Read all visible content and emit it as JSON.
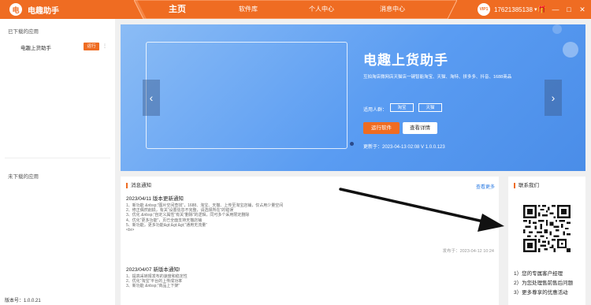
{
  "header": {
    "logo_char": "电",
    "title": "电趣助手",
    "nav": [
      "主页",
      "软件库",
      "个人中心",
      "消息中心"
    ],
    "vip_label": "VIP1",
    "phone": "17621385138",
    "chevron_glyph": "▾",
    "controls": {
      "gift": "🎁",
      "minimize": "—",
      "maximize": "□",
      "close": "✕"
    }
  },
  "sidebar": {
    "downloaded_heading": "已下载的应用",
    "app_name": "电趣上货助手",
    "run_badge": "运行",
    "more": "⋮",
    "not_downloaded_heading": "未下载的应用",
    "version": "版本号：1.0.0.21"
  },
  "banner": {
    "prev": "‹",
    "next": "›",
    "title": "电趣上货助手",
    "subtitle": "互拍淘店微网店天猫店一键智能淘宝、天猫、淘特、拼多多、抖音、1688商品",
    "people_label": "适用人群：",
    "tags": [
      "淘宝",
      "天猫"
    ],
    "run_button": "运行软件",
    "detail_button": "查看详情",
    "update": "更新于：2023-04-13 02:08 V 1.0.0.123"
  },
  "news": {
    "heading": "消息通知",
    "more": "查看更多",
    "items": [
      {
        "title": "2023/04/11 版本更新通知",
        "lines": [
          "1、新功能 &nbsp;“图片空间查找”，1688、淘宝、天猫、上传至淘宝店铺，仅占用少量空间",
          "2、修正偶然削损，有关“设置信息不完整，请选择所在”的错误",
          "3、优化 &nbsp;“自定义属性”有关“删除”的逻辑，同可多个采用限定删除",
          "4、优化“更多功能”，页已全面支持天猫店铺",
          "5、新功能，更多功能&gt;&gt;&gt;“通用无流量”",
          "<br>"
        ],
        "date": "发布于：2023-04-12 10:24"
      },
      {
        "title": "2023/04/07 新版本通知!",
        "lines": [
          "1、提高采转报发布的速度和稳定性",
          "2、优化“淘宝”平台的上传成功率",
          "3、新功能 &nbsp;“商品上下架”"
        ]
      }
    ]
  },
  "contact": {
    "heading": "联系我们",
    "lines": [
      "1）您的专属客户经理",
      "2）为您处理售前售后问题",
      "3）更多尊享的优惠活动"
    ]
  }
}
